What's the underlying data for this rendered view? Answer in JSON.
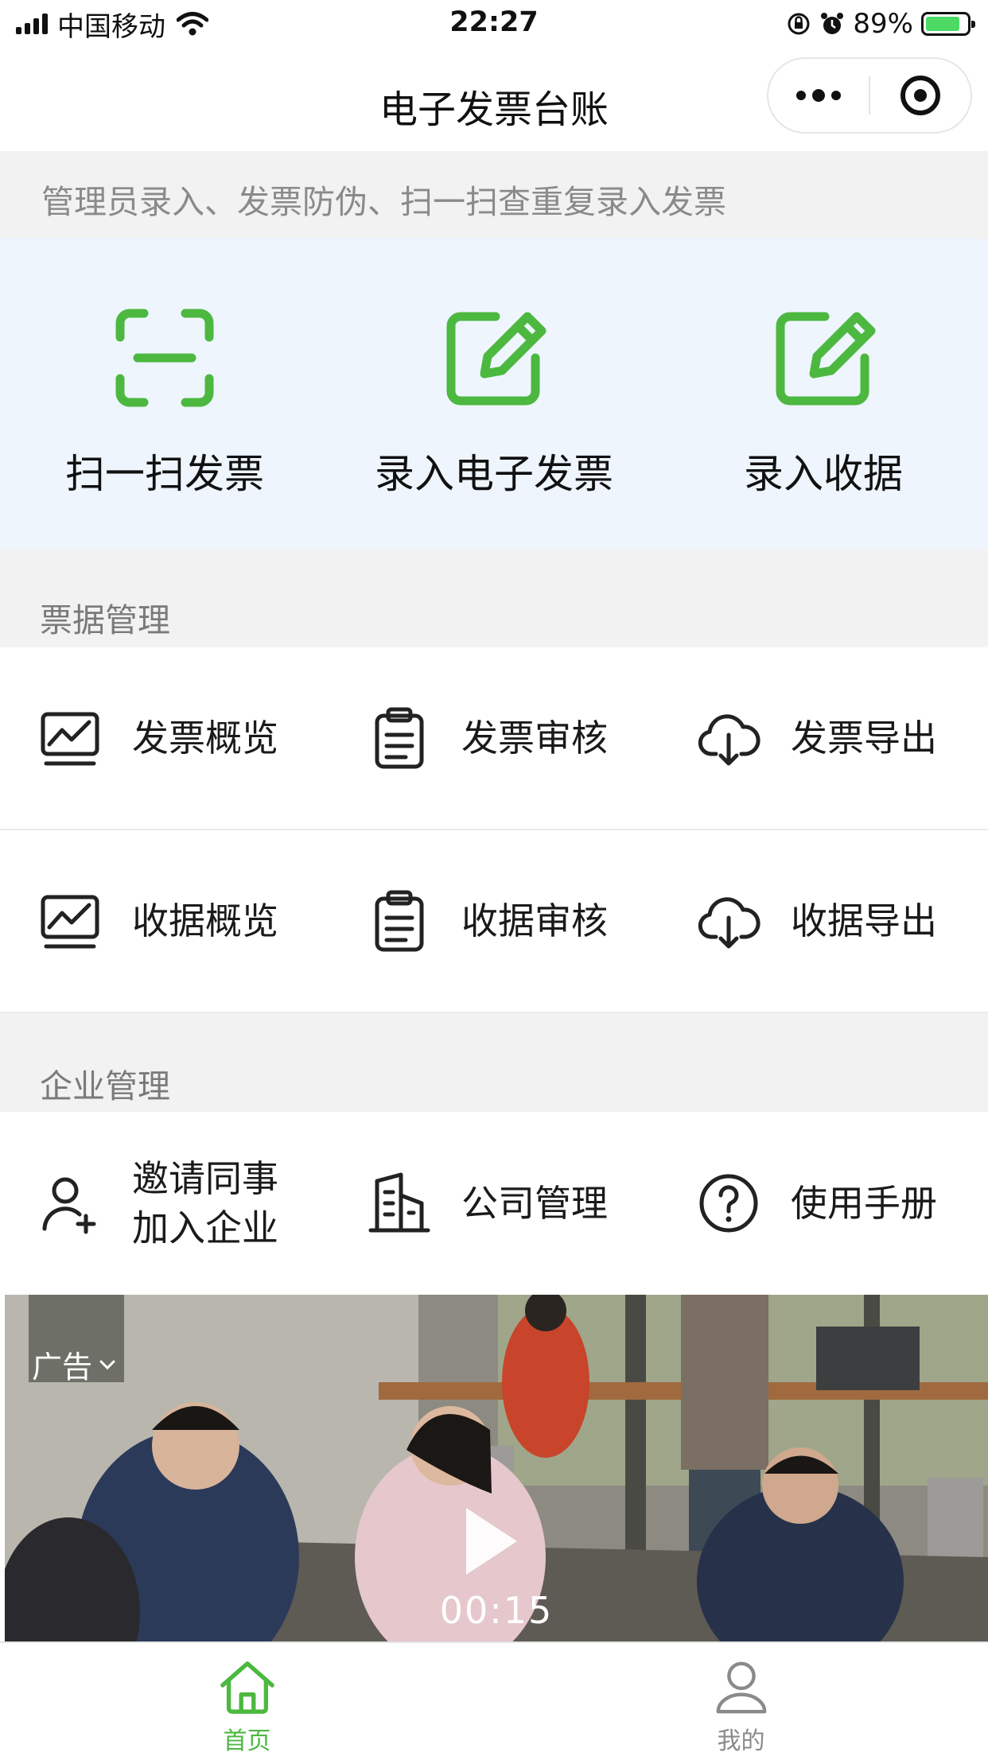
{
  "status_bar": {
    "carrier": "中国移动",
    "time": "22:27",
    "battery": "89%",
    "icons": [
      "signal-icon",
      "wifi-icon",
      "orientation-lock-icon",
      "alarm-icon",
      "battery-icon"
    ]
  },
  "nav": {
    "title": "电子发票台账",
    "more_icon": "more-dots-icon",
    "close_icon": "target-icon"
  },
  "notice": "管理员录入、发票防伪、扫一扫查重复录入发票",
  "quick_actions": [
    {
      "label": "扫一扫发票",
      "icon": "scan-icon"
    },
    {
      "label": "录入电子发票",
      "icon": "edit-icon"
    },
    {
      "label": "录入收据",
      "icon": "edit-icon"
    }
  ],
  "sections": {
    "bills": {
      "title": "票据管理",
      "rows": [
        [
          {
            "label": "发票概览",
            "icon": "chart-monitor-icon"
          },
          {
            "label": "发票审核",
            "icon": "clipboard-icon"
          },
          {
            "label": "发票导出",
            "icon": "cloud-download-icon"
          }
        ],
        [
          {
            "label": "收据概览",
            "icon": "chart-monitor-icon"
          },
          {
            "label": "收据审核",
            "icon": "clipboard-icon"
          },
          {
            "label": "收据导出",
            "icon": "cloud-download-icon"
          }
        ]
      ]
    },
    "company": {
      "title": "企业管理",
      "items": [
        {
          "label_line1": "邀请同事",
          "label_line2": "加入企业",
          "icon": "add-user-icon"
        },
        {
          "label": "公司管理",
          "icon": "building-icon"
        },
        {
          "label": "使用手册",
          "icon": "help-icon"
        }
      ]
    }
  },
  "ad": {
    "tag": "广告",
    "duration": "00:15"
  },
  "tabbar": [
    {
      "label": "首页",
      "icon": "home-icon",
      "active": true
    },
    {
      "label": "我的",
      "icon": "user-icon",
      "active": false
    }
  ],
  "colors": {
    "accent": "#4cb840",
    "quick_bg": "#eef5fd",
    "section_bg": "#f2f2f2",
    "muted_text": "#7a7a7a",
    "tab_inactive": "#8a8a8a"
  }
}
